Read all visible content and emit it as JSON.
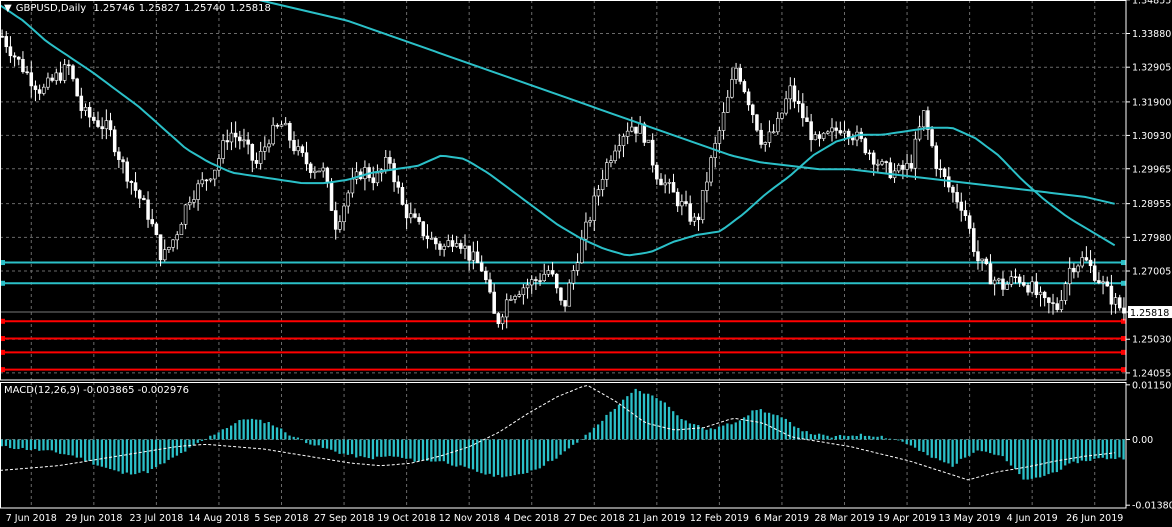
{
  "chart_data": [
    {
      "type": "candlestick",
      "title": "GBPUSD,Daily",
      "ohlc_text": [
        "1.25746",
        "1.25827",
        "1.25740",
        "1.25818"
      ],
      "ylim": [
        1.2385,
        1.3485
      ],
      "y_ticks": [
        "1.34855",
        "1.33880",
        "1.32905",
        "1.31900",
        "1.30930",
        "1.29965",
        "1.28955",
        "1.27980",
        "1.27005",
        "1.25818",
        "1.25030",
        "1.24055"
      ],
      "current_price": "1.25818",
      "x_ticks": [
        "7 Jun 2018",
        "29 Jun 2018",
        "23 Jul 2018",
        "14 Aug 2018",
        "5 Sep 2018",
        "27 Sep 2018",
        "19 Oct 2018",
        "12 Nov 2018",
        "4 Dec 2018",
        "27 Dec 2018",
        "21 Jan 2019",
        "12 Feb 2019",
        "6 Mar 2019",
        "28 Mar 2019",
        "19 Apr 2019",
        "13 May 2019",
        "4 Jun 2019",
        "26 Jun 2019"
      ],
      "close_path": [
        1.338,
        1.332,
        1.3265,
        1.322,
        1.326,
        1.329,
        1.316,
        1.3135,
        1.311,
        1.301,
        1.2935,
        1.286,
        1.2735,
        1.2805,
        1.2915,
        1.2955,
        1.3005,
        1.3105,
        1.3075,
        1.3005,
        1.309,
        1.3125,
        1.305,
        1.3005,
        1.2995,
        1.2835,
        1.2935,
        1.2995,
        1.2965,
        1.3025,
        1.2885,
        1.2835,
        1.2795,
        1.2765,
        1.2805,
        1.2745,
        1.2705,
        1.2545,
        1.2635,
        1.2655,
        1.2675,
        1.2705,
        1.2585,
        1.2735,
        1.2855,
        1.2985,
        1.3075,
        1.3125,
        1.3105,
        1.2985,
        1.2935,
        1.2885,
        1.2835,
        1.3005,
        1.3145,
        1.3295,
        1.3185,
        1.3065,
        1.3115,
        1.3225,
        1.3145,
        1.3065,
        1.3095,
        1.3125,
        1.3085,
        1.3045,
        1.2995,
        1.2985,
        1.3005,
        1.3155,
        1.3005,
        1.2935,
        1.2885,
        1.2735,
        1.2685,
        1.2655,
        1.2685,
        1.2655,
        1.2605,
        1.2595,
        1.2715,
        1.2735,
        1.2685,
        1.2625,
        1.2582
      ],
      "series": [
        {
          "name": "",
          "color": "#2bc0c8",
          "values": [
            1.347,
            1.3425,
            1.3365,
            1.332,
            1.3275,
            1.3225,
            1.3175,
            1.3115,
            1.3055,
            1.3015,
            1.2985,
            1.2975,
            1.2965,
            1.2955,
            1.2955,
            1.2965,
            1.2985,
            1.2995,
            1.3005,
            1.3035,
            1.3025,
            1.2985,
            1.2935,
            1.2885,
            1.2835,
            1.2795,
            1.2765,
            1.2745,
            1.2755,
            1.2785,
            1.2805,
            1.2815,
            1.2865,
            1.2925,
            1.2975,
            1.3035,
            1.3075,
            1.3095,
            1.3095,
            1.3105,
            1.3115,
            1.3115,
            1.3085,
            1.3035,
            1.2965,
            1.2905,
            1.2855,
            1.2815,
            1.2775
          ]
        },
        {
          "name": "",
          "color": "#2bc0c8",
          "values": [
            1.3485,
            1.3465,
            1.3445,
            1.3425,
            1.3395,
            1.3365,
            1.3335,
            1.3305,
            1.3275,
            1.3245,
            1.3215,
            1.3185,
            1.3155,
            1.3125,
            1.3095,
            1.3065,
            1.3035,
            1.3015,
            1.3005,
            1.2995,
            1.2995,
            1.2985,
            1.2975,
            1.2965,
            1.2955,
            1.2945,
            1.2935,
            1.2925,
            1.2915,
            1.2895
          ]
        }
      ],
      "levels_cyan": [
        1.2725,
        1.2665
      ],
      "levels_red": [
        1.2555,
        1.2505,
        1.2465,
        1.2415
      ],
      "level_colors": {
        "cyan": "#2bc0c8",
        "red": "#ff0000"
      }
    },
    {
      "type": "bar",
      "title": "MACD(12,26,9) -0.003865 -0.002976",
      "ylim": [
        -0.0144,
        0.0121
      ],
      "y_ticks": [
        "0.011509",
        "0.00",
        "-0.013809"
      ],
      "colors": {
        "histogram": "#2bc0c8",
        "signal": "#ffffff"
      },
      "macd_path": [
        -0.0015,
        -0.002,
        -0.0025,
        -0.0035,
        -0.0055,
        -0.0072,
        -0.0068,
        -0.004,
        -0.001,
        0.002,
        0.0045,
        0.0035,
        0.0005,
        -0.0015,
        -0.003,
        -0.004,
        -0.0035,
        -0.0045,
        -0.0045,
        -0.006,
        -0.0075,
        -0.0078,
        -0.006,
        -0.003,
        0.001,
        0.006,
        0.0105,
        0.0085,
        0.004,
        0.002,
        0.0035,
        0.0065,
        0.0045,
        0.0015,
        0.0005,
        0.001,
        0.0008,
        -0.0005,
        -0.0035,
        -0.0055,
        -0.002,
        -0.0035,
        -0.0088,
        -0.0072,
        -0.0048,
        -0.004,
        -0.0039
      ],
      "signal_path": [
        -0.0065,
        -0.006,
        -0.0055,
        -0.0045,
        -0.0035,
        -0.0025,
        -0.0015,
        -0.001,
        -0.0015,
        -0.002,
        -0.003,
        -0.004,
        -0.005,
        -0.0055,
        -0.005,
        -0.0035,
        -0.0015,
        0.0015,
        0.0055,
        0.009,
        0.0115,
        0.008,
        0.0035,
        0.002,
        0.0025,
        0.0045,
        0.0035,
        0.0005,
        -0.0005,
        -0.0015,
        -0.003,
        -0.0045,
        -0.0065,
        -0.0085,
        -0.0068,
        -0.0058,
        -0.0045,
        -0.0035,
        -0.0028
      ]
    }
  ]
}
